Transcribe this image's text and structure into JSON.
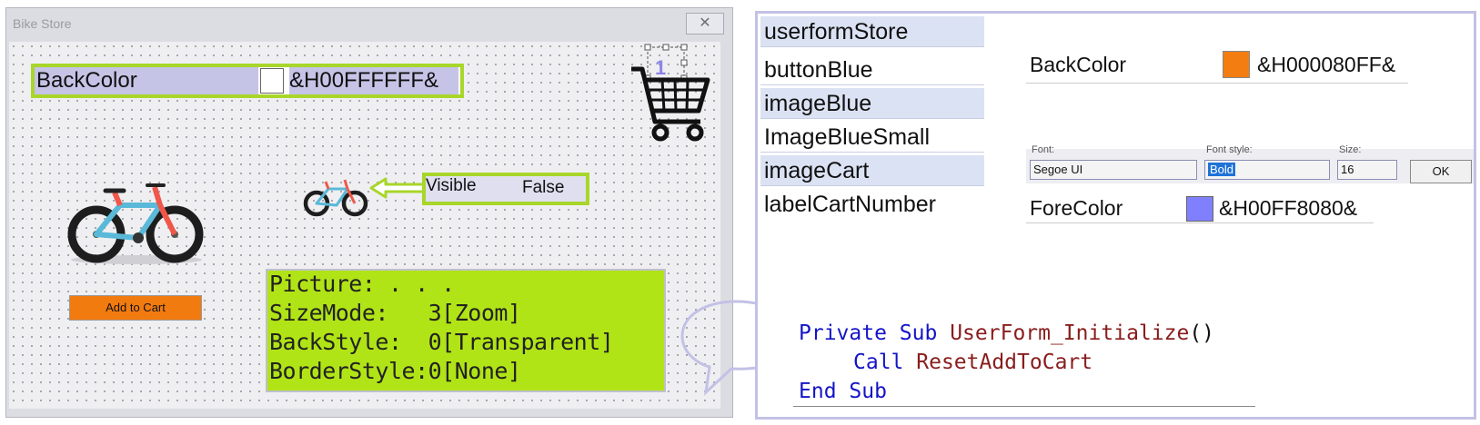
{
  "window": {
    "title": "Bike Store",
    "close_glyph": "✕"
  },
  "backcolor_prop": {
    "label": "BackColor",
    "value": "&H00FFFFFF&",
    "swatch_color": "#ffffff"
  },
  "cart": {
    "icon": "shopping-cart-icon",
    "count": "1"
  },
  "visible_prop": {
    "label": "Visible",
    "value": "False"
  },
  "add_to_cart_button": {
    "label": "Add to Cart",
    "color": "#f27b10"
  },
  "image_props": [
    "Picture: . . .",
    "SizeMode:   3[Zoom]",
    "BackStyle:  0[Transparent]",
    "BorderStyle:0[None]"
  ],
  "control_names": [
    "userformStore",
    "buttonBlue",
    "imageBlue",
    "ImageBlueSmall",
    "imageCart",
    "labelCartNumber"
  ],
  "button_backcolor": {
    "label": "BackColor",
    "value": "&H000080FF&",
    "swatch_color": "#f47d12"
  },
  "font_dialog": {
    "font_header": "Font:",
    "style_header": "Font style:",
    "size_header": "Size:",
    "font_value": "Segoe UI",
    "style_value": "Bold",
    "size_value": "16",
    "ok_label": "OK"
  },
  "cart_forecolor": {
    "label": "ForeColor",
    "value": "&H00FF8080&",
    "swatch_color": "#8080ff"
  },
  "code": {
    "line1_kw1": "Private",
    "line1_kw2": "Sub",
    "line1_name": "UserForm_Initialize",
    "line1_parens": "()",
    "line2_kw": "Call",
    "line2_name": "ResetAddToCart",
    "line3_kw1": "End",
    "line3_kw2": "Sub"
  },
  "colors": {
    "highlight_green": "#a8d62a",
    "prop_panel_green": "#b1e416",
    "accent_lavender": "#c3c1e6",
    "keyword_blue": "#1414c8",
    "identifier_red": "#8a1c1c"
  }
}
